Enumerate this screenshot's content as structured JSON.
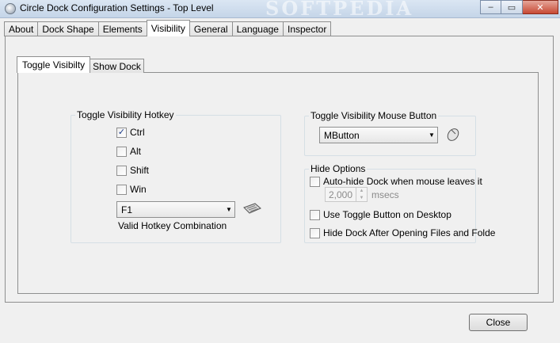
{
  "window": {
    "title": "Circle Dock Configuration Settings - Top Level",
    "watermark": "SOFTPEDIA",
    "buttons": {
      "minimize": "–",
      "maximize": "▭",
      "close": "✕"
    }
  },
  "tabs": [
    "About",
    "Dock Shape",
    "Elements",
    "Visibility",
    "General",
    "Language",
    "Inspector"
  ],
  "active_tab": "Visibility",
  "subtabs": [
    "Toggle Visibilty",
    "Show Dock"
  ],
  "active_subtab": "Toggle Visibilty",
  "hotkey_group": {
    "title": "Toggle Visibility Hotkey",
    "modifiers": [
      {
        "label": "Ctrl",
        "checked": true
      },
      {
        "label": "Alt",
        "checked": false
      },
      {
        "label": "Shift",
        "checked": false
      },
      {
        "label": "Win",
        "checked": false
      }
    ],
    "key_value": "F1",
    "status": "Valid Hotkey Combination",
    "icon": "keyboard-icon"
  },
  "mouse_group": {
    "title": "Toggle Visibility Mouse Button",
    "value": "MButton",
    "icon": "mouse-icon"
  },
  "hide_options": {
    "title": "Hide Options",
    "autohide": {
      "label": "Auto-hide Dock when mouse leaves it",
      "checked": false
    },
    "delay": {
      "value": "2,000",
      "unit": "msecs"
    },
    "toggle_button": {
      "label": "Use Toggle Button on Desktop",
      "checked": false
    },
    "hide_after_open": {
      "label": "Hide Dock After Opening Files and Folde",
      "checked": false
    }
  },
  "close_label": "Close",
  "colors": {
    "check_mark": "#1c3c8a",
    "close_button": "#c74934"
  }
}
